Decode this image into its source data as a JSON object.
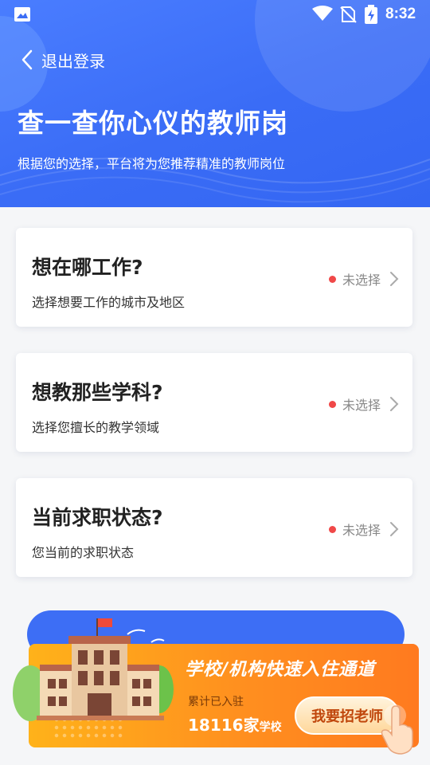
{
  "statusbar": {
    "time": "8:32",
    "icons": [
      "image-icon",
      "wifi-icon",
      "no-sim-icon",
      "battery-charging-icon"
    ]
  },
  "header": {
    "back_label": "退出登录",
    "title": "查一查你心仪的教师岗",
    "subtitle": "根据您的选择，平台将为您推荐精准的教师岗位"
  },
  "cards": [
    {
      "question": "想在哪工作?",
      "description": "选择想要工作的城市及地区",
      "status": "未选择"
    },
    {
      "question": "想教那些学科?",
      "description": "选择您擅长的教学领域",
      "status": "未选择"
    },
    {
      "question": "当前求职状态?",
      "description": "您当前的求职状态",
      "status": "未选择"
    }
  ],
  "banner": {
    "headline": "学校/机构快速入住通道",
    "count_label": "累计已入驻",
    "count_number": "18116家",
    "count_unit": "学校",
    "cta": "我要招老师"
  },
  "colors": {
    "header_blue": "#3d6ef5",
    "status_dot": "#f04848",
    "banner_orange": "#ff8f1f"
  }
}
